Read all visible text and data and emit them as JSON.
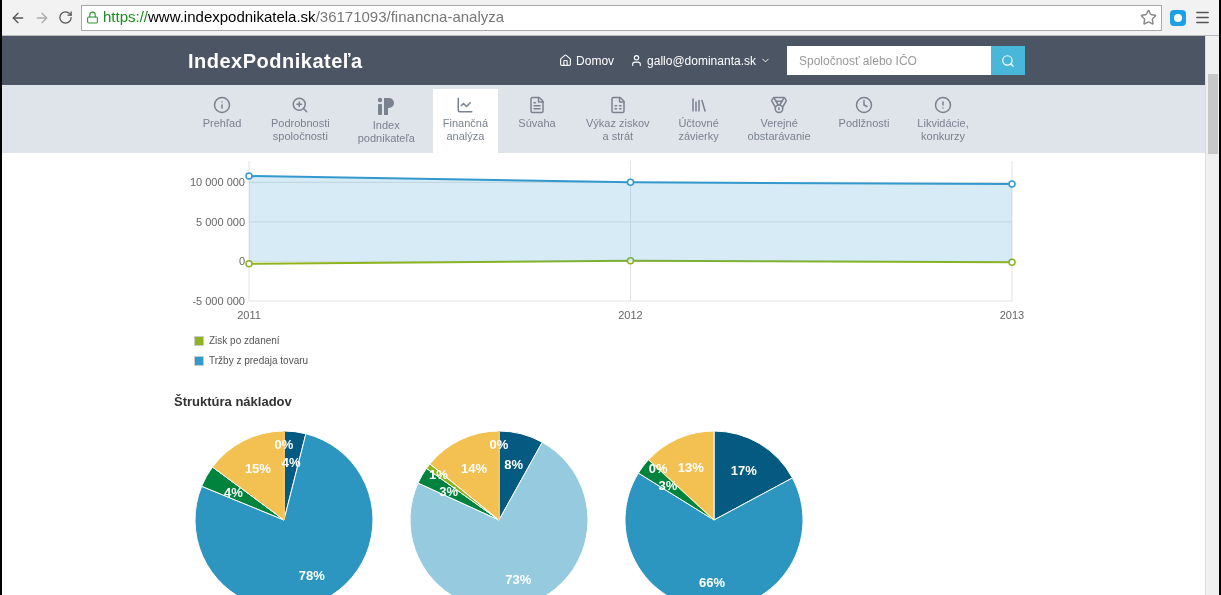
{
  "browser": {
    "url_scheme": "https://",
    "url_host": "www.indexpodnikatela.sk",
    "url_path": "/36171093/financna-analyza"
  },
  "header": {
    "logo": "IndexPodnikateľa",
    "nav": [
      "Domov",
      "gallo@dominanta.sk"
    ],
    "search": {
      "placeholder": "Spoločnosť alebo IČO"
    }
  },
  "tabs": [
    {
      "label": "Prehľad",
      "selected": false
    },
    {
      "label": "Podrobnosti\nspoločnosti",
      "selected": false
    },
    {
      "label": "Index\npodnikateľa",
      "selected": false
    },
    {
      "label": "Finančná\nanalýza",
      "selected": true
    },
    {
      "label": "Súvaha",
      "selected": false
    },
    {
      "label": "Výkaz ziskov\na strát",
      "selected": false
    },
    {
      "label": "Účtovné\nzávierky",
      "selected": false
    },
    {
      "label": "Verejné\nobstarávanie",
      "selected": false
    },
    {
      "label": "Podlžnosti",
      "selected": false
    },
    {
      "label": "Likvidácie,\nkonkurzy",
      "selected": false
    }
  ],
  "line_chart": {
    "chart_data": {
      "type": "line",
      "grid": true,
      "x": [
        "2011",
        "2012",
        "2013"
      ],
      "ylim": [
        -5000000,
        12700000
      ],
      "yticks": [
        {
          "value": -5000000,
          "label": "-5 000 000"
        },
        {
          "value": 0,
          "label": "0"
        },
        {
          "value": 5000000,
          "label": "5 000 000"
        },
        {
          "value": 10000000,
          "label": "10 000 000"
        }
      ],
      "series": [
        {
          "name": "Zisk po zdanení",
          "type": "line",
          "marker": true,
          "color": "#8db320",
          "values": [
            -300000,
            100000,
            -100000
          ]
        },
        {
          "name": "Tržby z predaja tovaru",
          "type": "area",
          "marker": true,
          "color": "#3399cc",
          "values": [
            10800000,
            10000000,
            9800000
          ]
        }
      ]
    }
  },
  "costs": {
    "title": "Štruktúra nákladov",
    "charts": [
      {
        "chart_data": {
          "type": "pie",
          "values": [
            4,
            78,
            4,
            15,
            0
          ],
          "value_labels": [
            "4%",
            "78%",
            "4%",
            "15%",
            "0%"
          ],
          "colors": [
            "#045a80",
            "#2c96c1",
            "#00843d",
            "#f3c151",
            "#f3c151"
          ]
        }
      },
      {
        "chart_data": {
          "type": "pie",
          "values": [
            8,
            73,
            3,
            1,
            14,
            0
          ],
          "value_labels": [
            "8%",
            "73%",
            "3%",
            "1%",
            "14%",
            "0%"
          ],
          "colors": [
            "#045a80",
            "#96cbdf",
            "#00843d",
            "#8db320",
            "#f3c151",
            "#f3c151"
          ]
        }
      },
      {
        "chart_data": {
          "type": "pie",
          "values": [
            17,
            66,
            3,
            0,
            13
          ],
          "value_labels": [
            "17%",
            "66%",
            "3%",
            "0%",
            "13%"
          ],
          "colors": [
            "#045a80",
            "#2c96c1",
            "#00843d",
            "#8db320",
            "#f3c151"
          ]
        }
      }
    ]
  }
}
